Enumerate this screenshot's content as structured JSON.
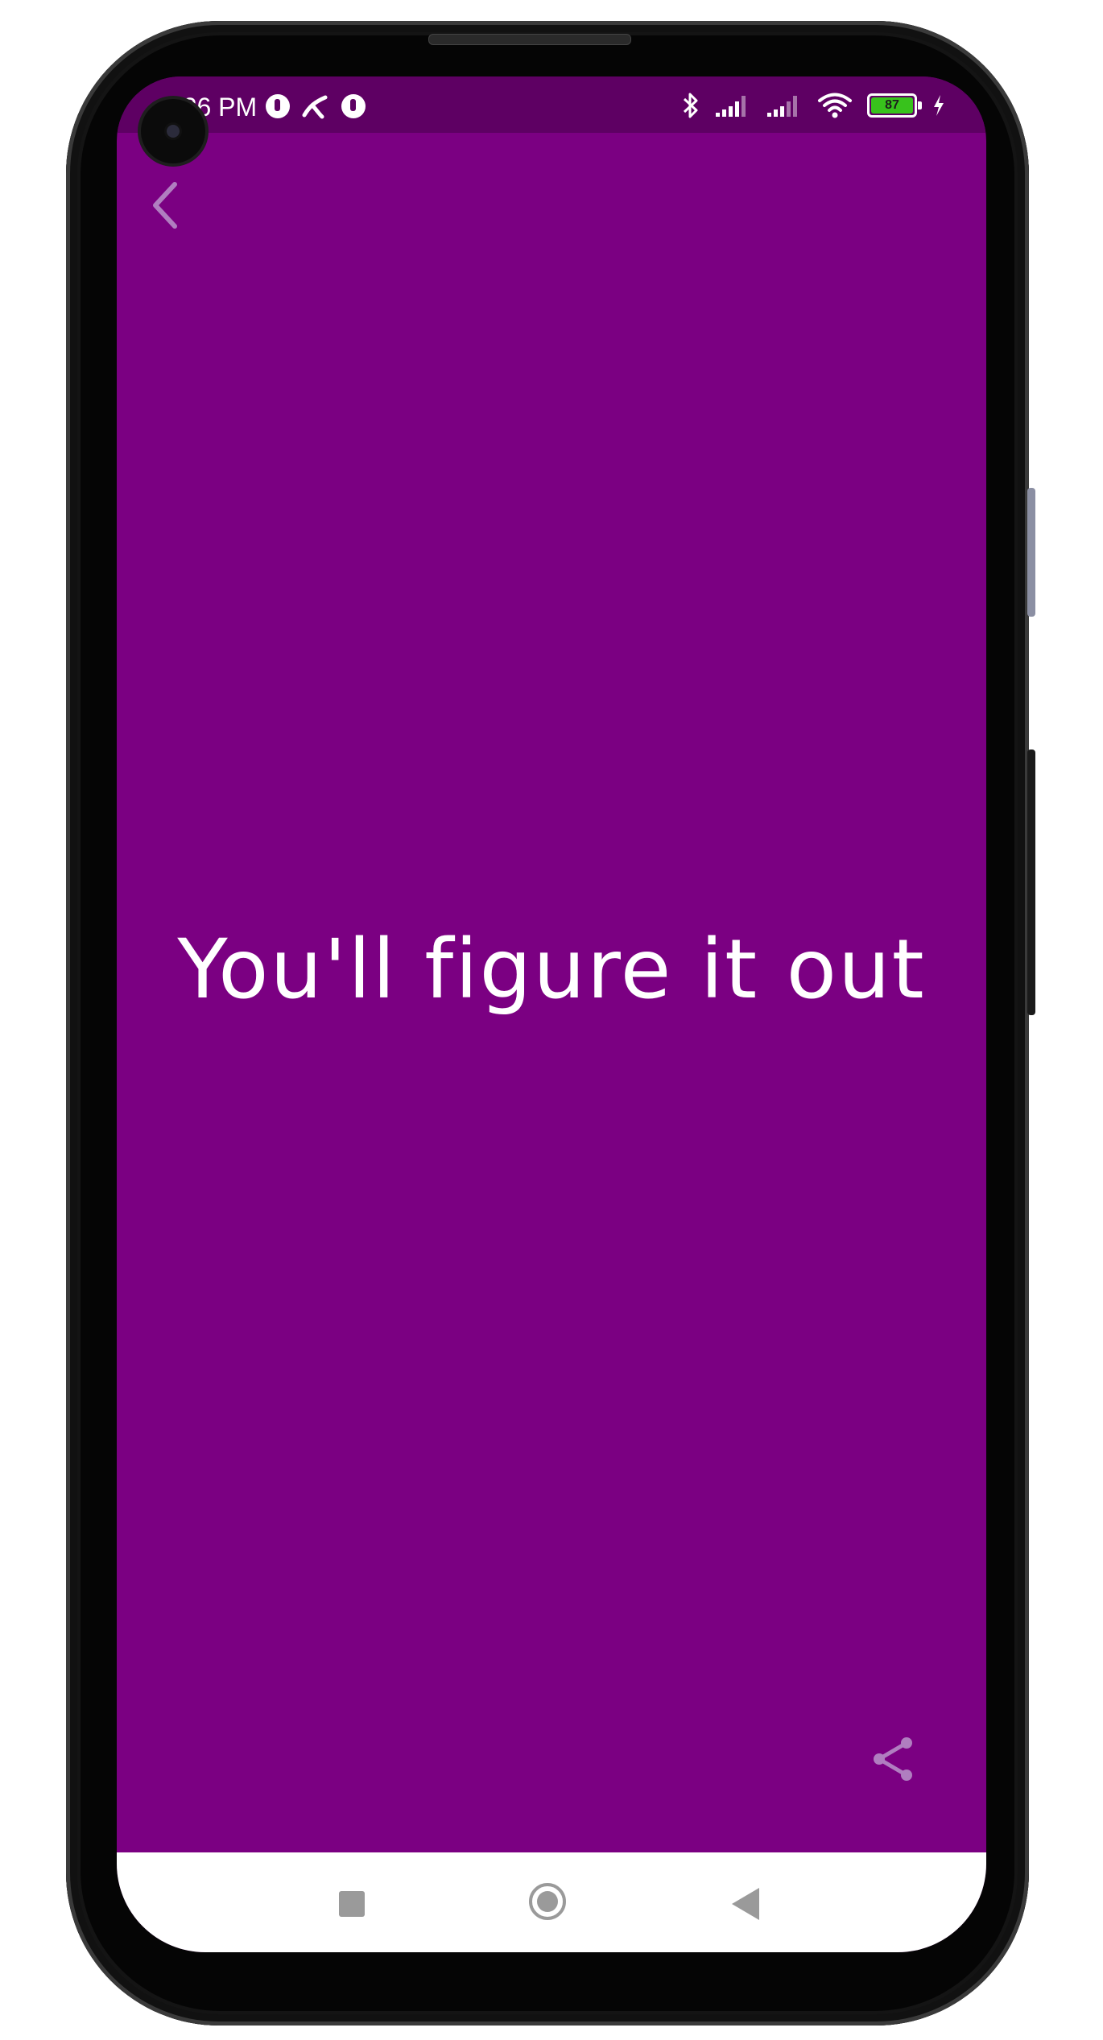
{
  "status_bar": {
    "time": "6:26 PM",
    "battery_level": "87",
    "icons": [
      "notification-icon",
      "telenor-icon",
      "notification-icon",
      "bluetooth-icon",
      "signal-icon",
      "signal-icon",
      "wifi-icon",
      "battery-icon",
      "charging-icon"
    ]
  },
  "screen": {
    "quote": "You'll figure it out",
    "background_color": "#7b0082",
    "status_bar_color": "#5e0063",
    "text_color": "#ffffff",
    "icon_color": "#b07ec0"
  },
  "toolbar": {
    "back_icon": "chevron-left-icon",
    "share_icon": "share-icon"
  },
  "navigation_bar": {
    "buttons": [
      "recent-apps-button",
      "home-button",
      "back-button"
    ]
  }
}
